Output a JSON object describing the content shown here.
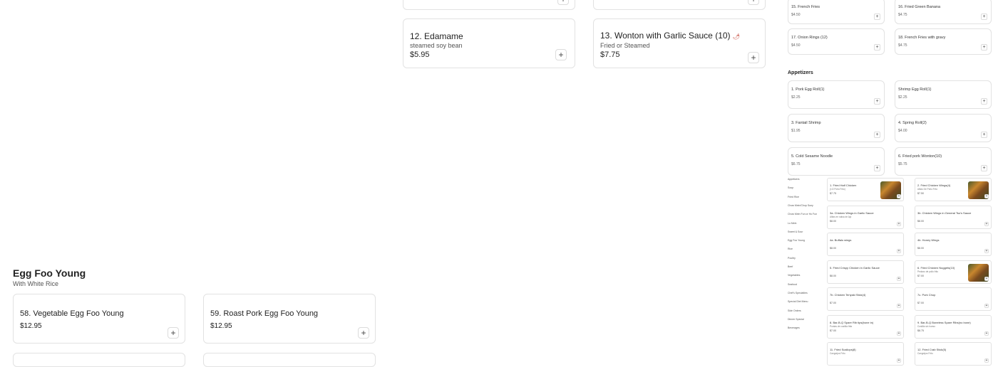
{
  "left_menu": {
    "edamame": {
      "title": "12. Edamame",
      "desc": "steamed soy bean",
      "price": "$5.95",
      "add": "+"
    },
    "wonton": {
      "title": "13. Wonton with Garlic Sauce (10)",
      "desc": "Fried or Steamed",
      "price": "$7.75",
      "add": "+"
    },
    "section": {
      "title": "Egg Foo Young",
      "subtitle": "With White Rice"
    },
    "items": [
      {
        "title": "58. Vegetable Egg Foo Young",
        "price": "$12.95",
        "add": "+"
      },
      {
        "title": "59. Roast Pork Egg Foo Young",
        "price": "$12.95",
        "add": "+"
      }
    ]
  },
  "right_menu": {
    "top_items": [
      {
        "name": "15. French Fries",
        "price": "$4.50"
      },
      {
        "name": "16. Fried Green Banana",
        "price": "$4.75"
      },
      {
        "name": "17. Onion Rings (12)",
        "price": "$4.50"
      },
      {
        "name": "18. French Fries with gravy",
        "price": "$4.75"
      }
    ],
    "appetizers_title": "Appetizers",
    "appetizers": [
      {
        "name": "1. Pork Egg Roll(1)",
        "price": "$2.25"
      },
      {
        "name": "Shrimp Egg Roll(1)",
        "price": "$2.25"
      },
      {
        "name": "3. Fantail Shrimp",
        "price": "$1.95"
      },
      {
        "name": "4. Spring Roll(2)",
        "price": "$4.00"
      },
      {
        "name": "5. Cold Sesame Noodle",
        "price": "$6.75"
      },
      {
        "name": "6. Fried pork Wonton(10)",
        "price": "$5.75"
      }
    ]
  },
  "tiny_nav": {
    "items": [
      "Appetizers",
      "Soup",
      "Fried Rice",
      "Chow Mein/Chop Suey",
      "Chow Mein Fun or Ho Fun",
      "Lo Mein",
      "Sweet & Sour",
      "Egg Foo Young",
      "Rice",
      "Poultry",
      "Beef",
      "Vegetables",
      "Seafood",
      "Chef's Specialties",
      "Special Diet Menu",
      "Side Orders",
      "Dinner Special",
      "Beverages"
    ]
  },
  "tiny_menu": [
    {
      "name": "1. Fried Half Chicken",
      "sub": "(1/2 Pollo Frito)",
      "price": "$7.75",
      "has_image": true
    },
    {
      "name": "2. Fried Chicken Wings(4)",
      "sub": "Alitas De Pollo Frito",
      "price": "$7.50",
      "has_image": true
    },
    {
      "name": "3a. Chicken Wings in Garlic Sauce",
      "sub": "Alitas en salsa de Ajo",
      "price": "$8.00",
      "has_image": false
    },
    {
      "name": "3b. Chicken Wings in General Tso's Sauce",
      "sub": "",
      "price": "$8.00",
      "has_image": false
    },
    {
      "name": "4a. Buffalo wings",
      "sub": "",
      "price": "$8.00",
      "has_image": false
    },
    {
      "name": "4b. Honey Wings",
      "sub": "",
      "price": "$8.00",
      "has_image": false
    },
    {
      "name": "5. Fried Crispy Chicken in Garlic Sauce",
      "sub": "",
      "price": "$8.00",
      "has_image": false
    },
    {
      "name": "6. Fried Chicken Nuggets(10)",
      "sub": "Pedazo de pollo frito",
      "price": "$7.00",
      "has_image": true
    },
    {
      "name": "7b. Chicken Teriyaki Stick(4)",
      "sub": "",
      "price": "$7.00",
      "has_image": false
    },
    {
      "name": "7c. Pork Chop",
      "sub": "",
      "price": "$7.00",
      "has_image": false
    },
    {
      "name": "8. Bar-B-Q Spare Rib tips(bone in)",
      "sub": "Puntas de costilla frita",
      "price": "$7.00",
      "has_image": false
    },
    {
      "name": "9. Bar-B-Q Boneless Spare Ribs(no bone)",
      "sub": "Costilla sin hueso",
      "price": "$8.75",
      "has_image": false
    },
    {
      "name": "11. Fried Scallops(8)",
      "sub": "Cangrejos Frito",
      "price": "",
      "has_image": false
    },
    {
      "name": "12. Fried Crab Stick(5)",
      "sub": "Cangrejos Frito",
      "price": "",
      "has_image": false
    }
  ],
  "colors": {
    "border": "#e2e2e2",
    "chili": "#c0392b"
  },
  "icons": {
    "add": "plus-icon",
    "spicy": "chili-icon"
  }
}
